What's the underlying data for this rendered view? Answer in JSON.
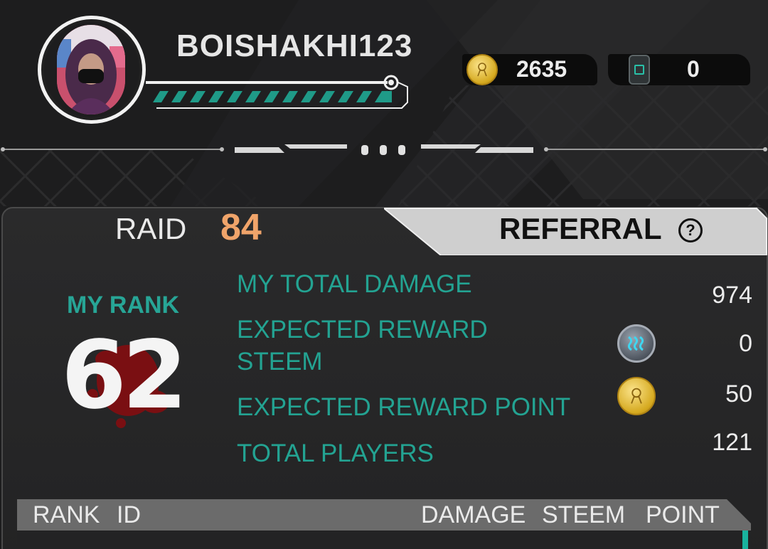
{
  "profile": {
    "username": "BOISHAKHI123"
  },
  "currencies": [
    {
      "icon": "gold-coin-icon",
      "value": "2635"
    },
    {
      "icon": "device-icon",
      "value": "0"
    }
  ],
  "tabs": {
    "raid_label": "RAID",
    "raid_number": "84",
    "referral_label": "REFERRAL",
    "help_symbol": "?"
  },
  "rank": {
    "label": "MY RANK",
    "value": "62"
  },
  "stats": {
    "total_damage_label": "MY TOTAL DAMAGE",
    "total_damage_value": "974",
    "reward_steem_label_line1": "EXPECTED REWARD",
    "reward_steem_label_line2": "STEEM",
    "reward_steem_value": "0",
    "reward_point_label": "EXPECTED REWARD POINT",
    "reward_point_value": "50",
    "total_players_label": "TOTAL PLAYERS",
    "total_players_value": "121"
  },
  "table": {
    "columns": [
      "RANK",
      "ID",
      "DAMAGE",
      "STEEM",
      "POINT"
    ]
  },
  "colors": {
    "accent_teal": "#23a392",
    "raid_orange": "#f0a46a",
    "background": "#1e1e1f"
  }
}
